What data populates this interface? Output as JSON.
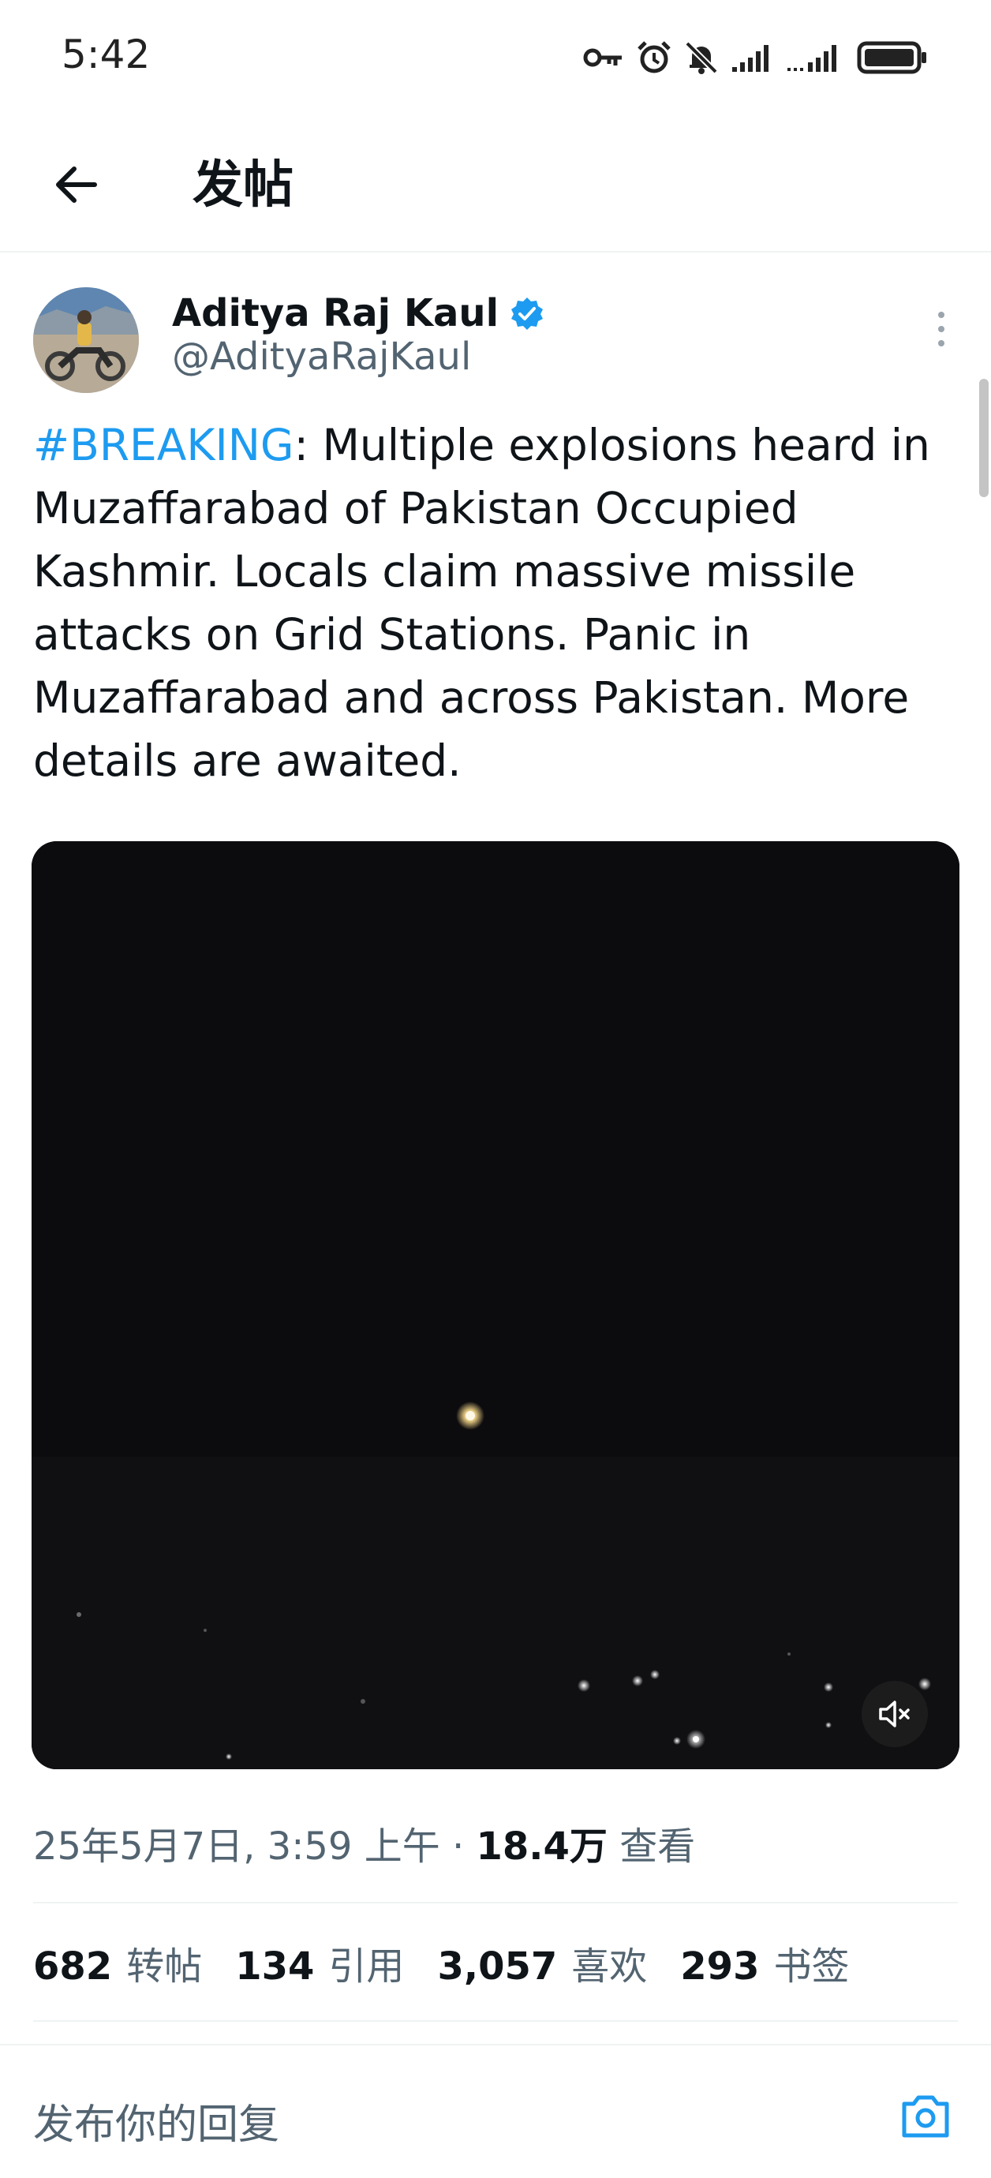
{
  "status_bar": {
    "time": "5:42"
  },
  "header": {
    "title": "发帖"
  },
  "author": {
    "name": "Aditya Raj Kaul",
    "handle": "@AdityaRajKaul",
    "verified": true
  },
  "tweet": {
    "hashtag": "#BREAKING",
    "text": ": Multiple explosions heard in Muzaffarabad of Pakistan Occupied Kashmir. Locals claim massive missile attacks on Grid Stations. Panic in Muzaffarabad and across Pakistan. More details are awaited."
  },
  "meta": {
    "date_time": "25年5月7日, 3:59 上午 · ",
    "views_count": "18.4万",
    "views_label": " 查看"
  },
  "stats": [
    {
      "count": "682",
      "label": "转帖"
    },
    {
      "count": "134",
      "label": "引用"
    },
    {
      "count": "3,057",
      "label": "喜欢"
    },
    {
      "count": "293",
      "label": "书签"
    }
  ],
  "reply": {
    "placeholder": "发布你的回复"
  },
  "icons": {
    "back": "arrow-left-icon",
    "verified": "verified-badge-icon",
    "more": "more-vertical-icon",
    "mute": "volume-muted-icon",
    "camera": "camera-icon"
  },
  "colors": {
    "accent": "#1d9bf0",
    "text": "#0f1419",
    "secondary": "#536471"
  }
}
